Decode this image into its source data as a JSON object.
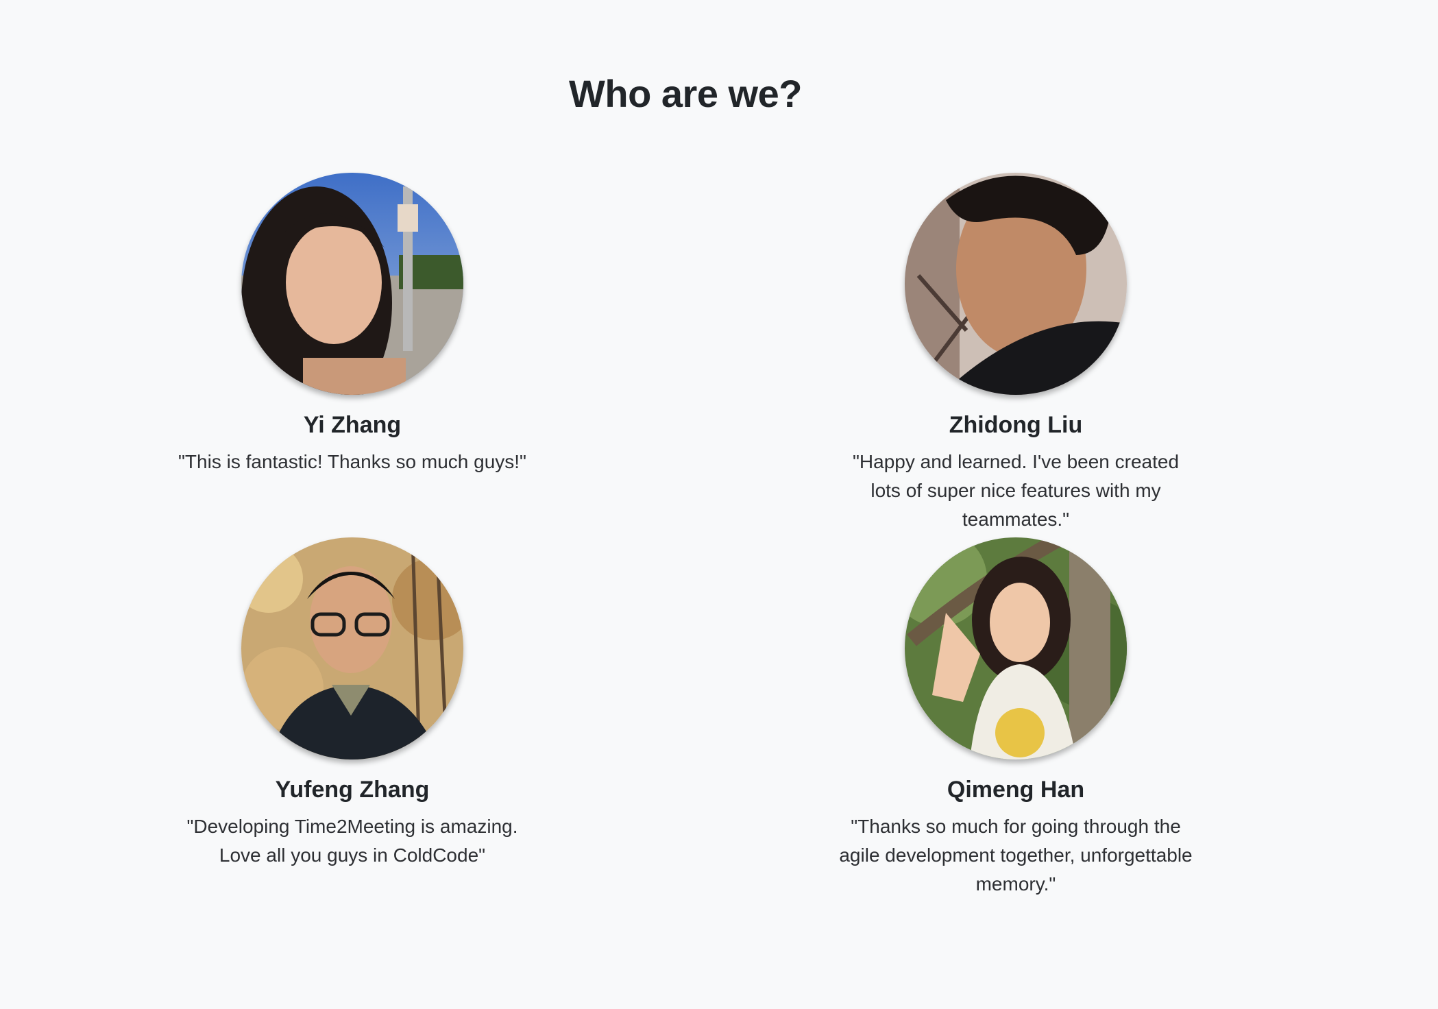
{
  "section": {
    "title": "Who are we?"
  },
  "members": [
    {
      "name": "Yi Zhang",
      "quote": "\"This is fantastic! Thanks so much guys!\"",
      "photo_icon": "portrait-photo"
    },
    {
      "name": "Zhidong Liu",
      "quote": "\"Happy and learned. I've been created lots of super nice features with my teammates.\"",
      "photo_icon": "portrait-photo"
    },
    {
      "name": "Yufeng Zhang",
      "quote": "\"Developing Time2Meeting is amazing. Love all you guys in ColdCode\"",
      "photo_icon": "portrait-photo"
    },
    {
      "name": "Qimeng Han",
      "quote": "\"Thanks so much for going through the agile development together, unforgettable memory.\"",
      "photo_icon": "portrait-photo"
    }
  ],
  "colors": {
    "background": "#f8f9fa",
    "text": "#212529"
  }
}
